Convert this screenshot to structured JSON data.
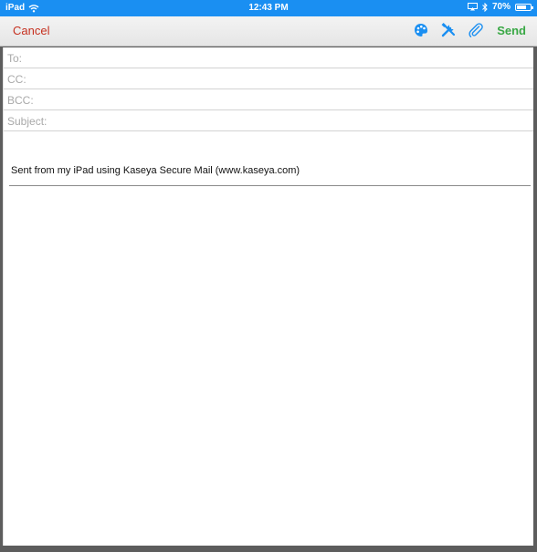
{
  "status_bar": {
    "device": "iPad",
    "time": "12:43 PM",
    "battery_text": "70%",
    "battery_level": 0.7
  },
  "toolbar": {
    "cancel_label": "Cancel",
    "icons": [
      "palette-icon",
      "tools-icon",
      "paperclip-icon"
    ],
    "send_label": "Send"
  },
  "compose": {
    "to_label": "To:",
    "cc_label": "CC:",
    "bcc_label": "BCC:",
    "subject_label": "Subject:",
    "signature": "Sent from my iPad using Kaseya Secure Mail (www.kaseya.com)"
  },
  "colors": {
    "status_bar": "#1a8ff2",
    "cancel": "#c6301f",
    "send": "#39a845",
    "icon": "#1a8ff2"
  }
}
